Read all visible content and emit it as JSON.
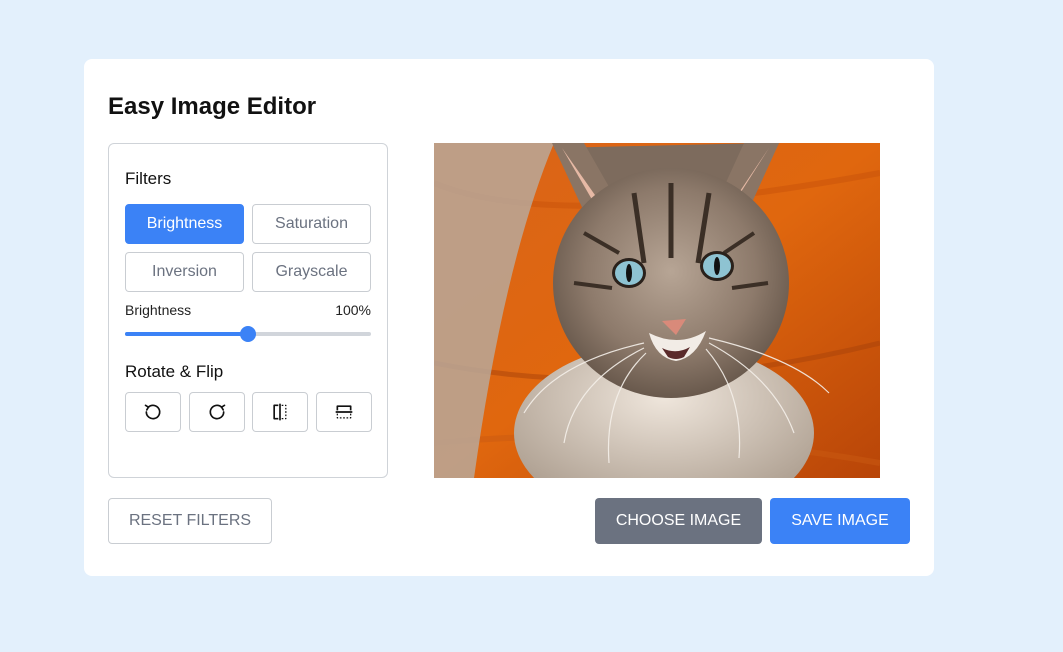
{
  "app": {
    "title": "Easy Image Editor"
  },
  "filters": {
    "heading": "Filters",
    "buttons": [
      {
        "label": "Brightness",
        "active": true
      },
      {
        "label": "Saturation",
        "active": false
      },
      {
        "label": "Inversion",
        "active": false
      },
      {
        "label": "Grayscale",
        "active": false
      }
    ],
    "slider": {
      "label": "Brightness",
      "value_text": "100%",
      "level_fraction": 0.5
    }
  },
  "rotate_flip": {
    "heading": "Rotate & Flip",
    "buttons": [
      "rotate-left-icon",
      "rotate-right-icon",
      "flip-horizontal-icon",
      "flip-vertical-icon"
    ]
  },
  "actions": {
    "reset_label": "RESET FILTERS",
    "choose_label": "CHOOSE IMAGE",
    "save_label": "SAVE IMAGE"
  },
  "colors": {
    "accent": "#3b82f6",
    "secondary": "#6b7280",
    "background": "#e3f0fc"
  }
}
